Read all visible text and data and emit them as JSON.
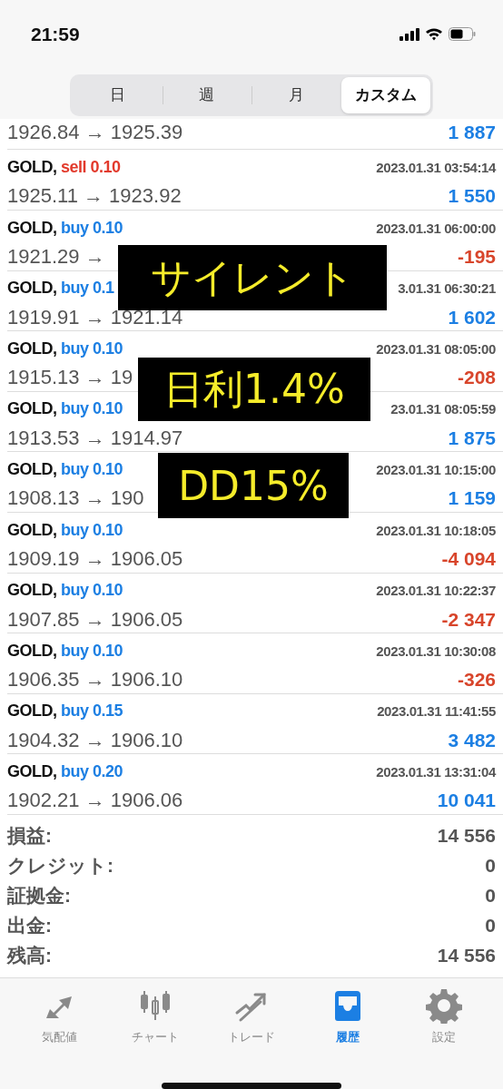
{
  "status_bar": {
    "time": "21:59"
  },
  "period_tabs": [
    {
      "label": "日",
      "selected": false
    },
    {
      "label": "週",
      "selected": false
    },
    {
      "label": "月",
      "selected": false
    },
    {
      "label": "カスタム",
      "selected": true
    }
  ],
  "deals": [
    {
      "prices": "1926.84 → 1925.39",
      "profit": "1 887",
      "loss": false
    },
    {
      "symbol": "GOLD,",
      "order": "sell 0.10",
      "kind": "sell",
      "time": "2023.01.31 03:54:14",
      "prices": "1925.11 → 1923.92",
      "profit": "1 550",
      "loss": false
    },
    {
      "symbol": "GOLD,",
      "order": "buy 0.10",
      "kind": "buy",
      "time": "2023.01.31 06:00:00",
      "prices": "1921.29 →",
      "profit": "-195",
      "loss": true
    },
    {
      "symbol": "GOLD,",
      "order": "buy 0.1",
      "kind": "buy",
      "time": "3.01.31 06:30:21",
      "prices": "1919.91 → 1921.14",
      "profit": "1 602",
      "loss": false
    },
    {
      "symbol": "GOLD,",
      "order": "buy 0.10",
      "kind": "buy",
      "time": "2023.01.31 08:05:00",
      "prices": "1915.13 → 19",
      "profit": "-208",
      "loss": true
    },
    {
      "symbol": "GOLD,",
      "order": "buy 0.10",
      "kind": "buy",
      "time": "23.01.31 08:05:59",
      "prices": "1913.53 → 1914.97",
      "profit": "1 875",
      "loss": false
    },
    {
      "symbol": "GOLD,",
      "order": "buy 0.10",
      "kind": "buy",
      "time": "2023.01.31 10:15:00",
      "prices": "1908.13 → 190",
      "profit": "1 159",
      "loss": false
    },
    {
      "symbol": "GOLD,",
      "order": "buy 0.10",
      "kind": "buy",
      "time": "2023.01.31 10:18:05",
      "prices": "1909.19 → 1906.05",
      "profit": "-4 094",
      "loss": true
    },
    {
      "symbol": "GOLD,",
      "order": "buy 0.10",
      "kind": "buy",
      "time": "2023.01.31 10:22:37",
      "prices": "1907.85 → 1906.05",
      "profit": "-2 347",
      "loss": true
    },
    {
      "symbol": "GOLD,",
      "order": "buy 0.10",
      "kind": "buy",
      "time": "2023.01.31 10:30:08",
      "prices": "1906.35 → 1906.10",
      "profit": "-326",
      "loss": true
    },
    {
      "symbol": "GOLD,",
      "order": "buy 0.15",
      "kind": "buy",
      "time": "2023.01.31 11:41:55",
      "prices": "1904.32 → 1906.10",
      "profit": "3 482",
      "loss": false
    },
    {
      "symbol": "GOLD,",
      "order": "buy 0.20",
      "kind": "buy",
      "time": "2023.01.31 13:31:04",
      "prices": "1902.21 → 1906.06",
      "profit": "10 041",
      "loss": false
    }
  ],
  "summary": [
    {
      "label": "損益:",
      "value": "14 556"
    },
    {
      "label": "クレジット:",
      "value": "0"
    },
    {
      "label": "証拠金:",
      "value": "0"
    },
    {
      "label": "出金:",
      "value": "0"
    },
    {
      "label": "残高:",
      "value": "14 556"
    }
  ],
  "overlays": [
    {
      "text": "サイレント"
    },
    {
      "text": "日利1.4%"
    },
    {
      "text": "DD15%"
    }
  ],
  "tab_bar": [
    {
      "label": "気配値",
      "selected": false
    },
    {
      "label": "チャート",
      "selected": false
    },
    {
      "label": "トレード",
      "selected": false
    },
    {
      "label": "履歴",
      "selected": true
    },
    {
      "label": "設定",
      "selected": false
    }
  ]
}
